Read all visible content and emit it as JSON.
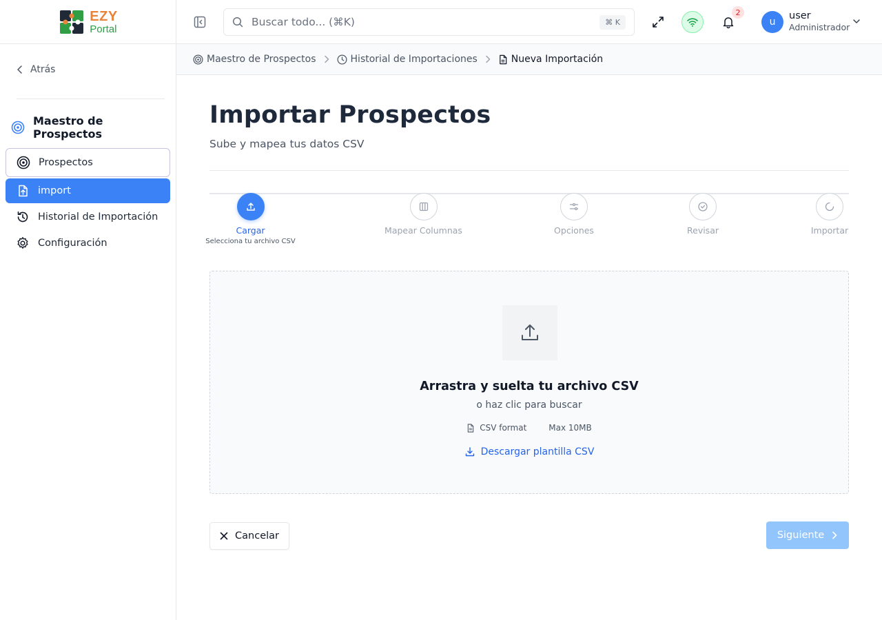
{
  "app": {
    "logo_ezy": "EZY",
    "logo_portal": "Portal"
  },
  "sidebar": {
    "back_label": "Atrás",
    "module_title": "Maestro de Prospectos",
    "items": [
      {
        "label": "Prospectos",
        "icon": "target-icon",
        "state": "outlined"
      },
      {
        "label": "import",
        "icon": "file-upload-icon",
        "state": "active"
      },
      {
        "label": "Historial de Importación",
        "icon": "history-icon",
        "state": "normal"
      },
      {
        "label": "Configuración",
        "icon": "gear-icon",
        "state": "normal"
      }
    ]
  },
  "header": {
    "search_placeholder": "Buscar todo... (⌘K)",
    "search_shortcut": "⌘ K",
    "notifications_count": "2",
    "user_initial": "u",
    "user_name": "user",
    "user_role": "Administrador"
  },
  "breadcrumb": [
    {
      "label": "Maestro de Prospectos",
      "icon": "target-icon"
    },
    {
      "label": "Historial de Importaciones",
      "icon": "clock-icon"
    },
    {
      "label": "Nueva Importación",
      "icon": "file-icon"
    }
  ],
  "page": {
    "title": "Importar Prospectos",
    "subtitle": "Sube y mapea tus datos CSV"
  },
  "stepper": {
    "steps": [
      {
        "label": "Cargar",
        "desc": "Selecciona tu archivo CSV",
        "icon": "upload-icon",
        "active": true
      },
      {
        "label": "Mapear Columnas",
        "desc": "",
        "icon": "columns-icon",
        "active": false
      },
      {
        "label": "Opciones",
        "desc": "",
        "icon": "sliders-icon",
        "active": false
      },
      {
        "label": "Revisar",
        "desc": "",
        "icon": "check-circle-icon",
        "active": false
      },
      {
        "label": "Importar",
        "desc": "",
        "icon": "loader-icon",
        "active": false
      }
    ]
  },
  "dropzone": {
    "title": "Arrastra y suelta tu archivo CSV",
    "subtitle": "o haz clic para buscar",
    "format_label": "CSV format",
    "size_label": "Max 10MB",
    "template_link": "Descargar plantilla CSV"
  },
  "actions": {
    "cancel_label": "Cancelar",
    "next_label": "Siguiente"
  },
  "colors": {
    "primary": "#3b82f6",
    "primary_disabled": "#93c5fd",
    "logo_orange": "#e8833a",
    "logo_green": "#2f9e44"
  }
}
